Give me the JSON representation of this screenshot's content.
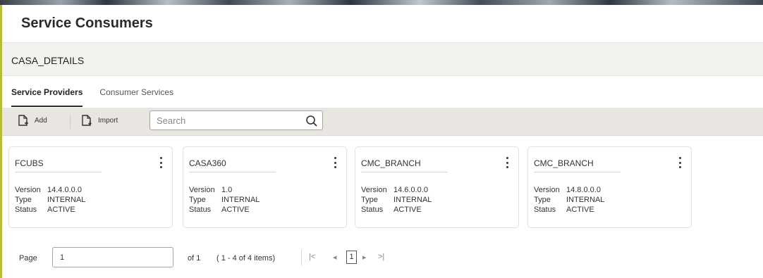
{
  "page": {
    "title": "Service Consumers"
  },
  "section": {
    "title": "CASA_DETAILS"
  },
  "tabs": [
    {
      "label": "Service Providers",
      "active": true
    },
    {
      "label": "Consumer Services",
      "active": false
    }
  ],
  "toolbar": {
    "add_label": "Add",
    "import_label": "Import",
    "search_placeholder": "Search"
  },
  "field_labels": {
    "version": "Version",
    "type": "Type",
    "status": "Status"
  },
  "cards": [
    {
      "name": "FCUBS",
      "version": "14.4.0.0.0",
      "type": "INTERNAL",
      "status": "ACTIVE"
    },
    {
      "name": "CASA360",
      "version": "1.0",
      "type": "INTERNAL",
      "status": "ACTIVE"
    },
    {
      "name": "CMC_BRANCH",
      "version": "14.6.0.0.0",
      "type": "INTERNAL",
      "status": "ACTIVE"
    },
    {
      "name": "CMC_BRANCH",
      "version": "14.8.0.0.0",
      "type": "INTERNAL",
      "status": "ACTIVE"
    }
  ],
  "pagination": {
    "page_label": "Page",
    "page_value": "1",
    "of_text": "of 1",
    "items_text": "( 1 - 4 of 4 items)",
    "current_page": "1"
  },
  "colors": {
    "accent": "#b5bd3a",
    "toolbar_bg": "#e9e6e2",
    "section_bg": "#f4f2ef"
  },
  "icons": {
    "add": "add-document-icon",
    "import": "import-document-icon",
    "search": "search-icon",
    "card_menu": "kebab-menu-icon"
  }
}
